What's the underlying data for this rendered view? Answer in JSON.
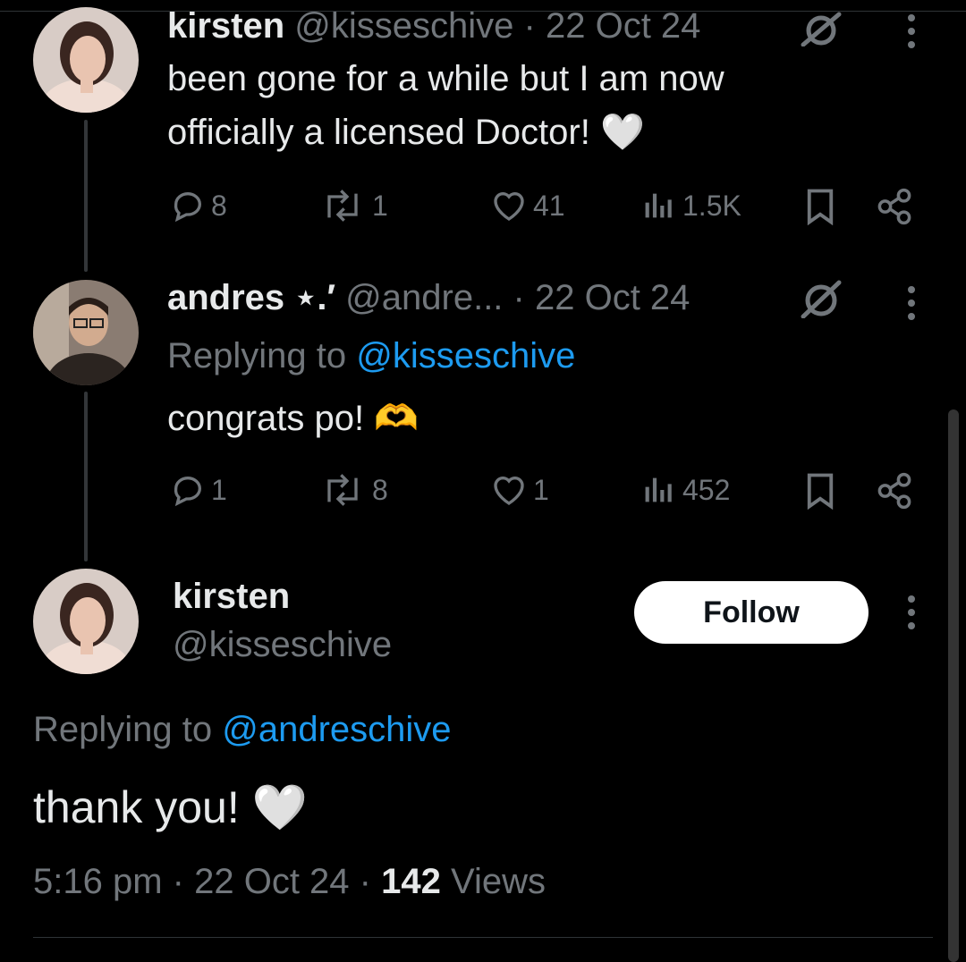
{
  "tweet1": {
    "name": "kirsten",
    "handle": "@kisseschive",
    "dot_date": "· 22 Oct 24",
    "text_line1": "been gone for a while but I am now",
    "text_line2": "officially a licensed Doctor!",
    "emoji": "🤍",
    "replies": "8",
    "retweets": "1",
    "likes": "41",
    "views": "1.5K"
  },
  "tweet2": {
    "name": "andres",
    "name_suffix": "⋆.′",
    "handle": "@andre...",
    "dot_date": "· 22 Oct 24",
    "replying_prefix": "Replying to",
    "replying_handle": "@kisseschive",
    "text": "congrats po!",
    "emoji": "🫶",
    "replies": "1",
    "retweets": "8",
    "likes": "1",
    "views": "452"
  },
  "main_tweet": {
    "name": "kirsten",
    "handle": "@kisseschive",
    "follow_label": "Follow",
    "replying_prefix": "Replying to",
    "replying_handle": "@andreschive",
    "text": "thank you!",
    "emoji": "🤍",
    "time": "5:16 pm",
    "date": "22 Oct 24",
    "sep": "·",
    "views_count": "142",
    "views_label": "Views"
  },
  "colors": {
    "background": "#000000",
    "text": "#e7e9ea",
    "muted": "#71767b",
    "link": "#1d9bf0"
  }
}
